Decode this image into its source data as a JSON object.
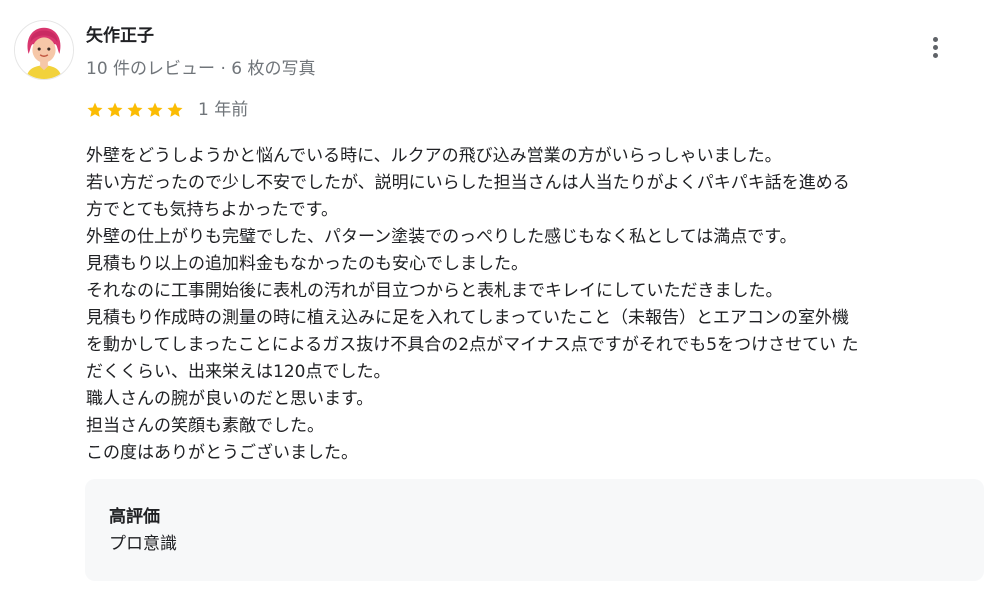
{
  "reviewer": {
    "name": "矢作正子",
    "meta": "10 件のレビュー · 6 枚の写真",
    "avatar_icon": "avatar-woman-red-hair-icon"
  },
  "menu": {
    "more_icon": "more-vertical-icon"
  },
  "rating": {
    "stars": 5,
    "max": 5,
    "star_color": "#fbbc04",
    "date": "1 年前"
  },
  "review": {
    "lines": [
      "外壁をどうしようかと悩んでいる時に、ルクアの飛び込み営業の方がいらっしゃいました。",
      "若い方だったので少し不安でしたが、説明にいらした担当さんは人当たりがよくパキパキ話を進める",
      "方でとても気持ちよかったです。",
      "外壁の仕上がりも完璧でした、パターン塗装でのっぺりした感じもなく私としては満点です。",
      "見積もり以上の追加料金もなかったのも安心でしました。",
      "それなのに工事開始後に表札の汚れが目立つからと表札までキレイにしていただきました。",
      "見積もり作成時の測量の時に植え込みに足を入れてしまっていたこと（未報告）とエアコンの室外機",
      "を動かしてしまったことによるガス抜け不具合の2点がマイナス点ですがそれでも5をつけさせてい た",
      "だくくらい、出来栄えは120点でした。",
      "職人さんの腕が良いのだと思います。",
      "担当さんの笑顔も素敵でした。",
      "この度はありがとうございました。"
    ]
  },
  "highlight": {
    "title": "高評価",
    "value": "プロ意識"
  }
}
